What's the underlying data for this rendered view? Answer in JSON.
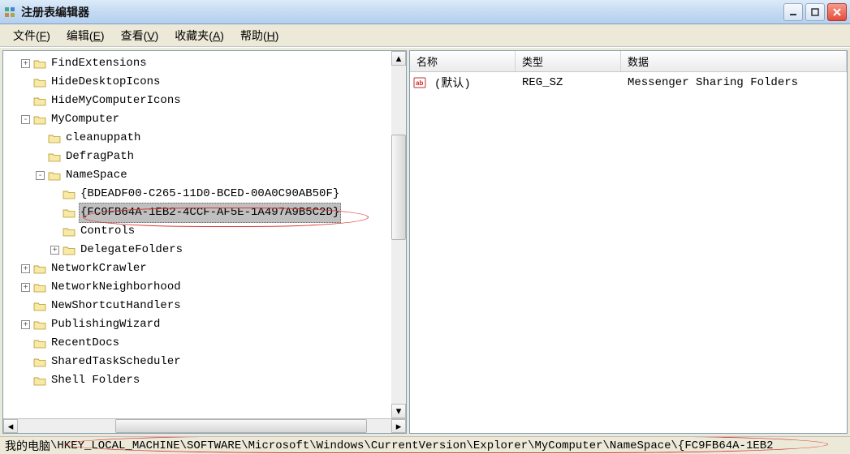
{
  "window": {
    "title": "注册表编辑器"
  },
  "menus": {
    "file": {
      "label": "文件",
      "hotkey": "F"
    },
    "edit": {
      "label": "编辑",
      "hotkey": "E"
    },
    "view": {
      "label": "查看",
      "hotkey": "V"
    },
    "favorites": {
      "label": "收藏夹",
      "hotkey": "A"
    },
    "help": {
      "label": "帮助",
      "hotkey": "H"
    }
  },
  "tree": {
    "items": [
      {
        "indent": 1,
        "toggle": "+",
        "label": "FindExtensions"
      },
      {
        "indent": 1,
        "toggle": "",
        "label": "HideDesktopIcons"
      },
      {
        "indent": 1,
        "toggle": "",
        "label": "HideMyComputerIcons"
      },
      {
        "indent": 1,
        "toggle": "-",
        "label": "MyComputer"
      },
      {
        "indent": 2,
        "toggle": "",
        "label": "cleanuppath"
      },
      {
        "indent": 2,
        "toggle": "",
        "label": "DefragPath"
      },
      {
        "indent": 2,
        "toggle": "-",
        "label": "NameSpace"
      },
      {
        "indent": 3,
        "toggle": "",
        "label": "{BDEADF00-C265-11D0-BCED-00A0C90AB50F}"
      },
      {
        "indent": 3,
        "toggle": "",
        "label": "{FC9FB64A-1EB2-4CCF-AF5E-1A497A9B5C2D}",
        "selected": true
      },
      {
        "indent": 3,
        "toggle": "",
        "label": "Controls"
      },
      {
        "indent": 3,
        "toggle": "+",
        "label": "DelegateFolders"
      },
      {
        "indent": 1,
        "toggle": "+",
        "label": "NetworkCrawler"
      },
      {
        "indent": 1,
        "toggle": "+",
        "label": "NetworkNeighborhood"
      },
      {
        "indent": 1,
        "toggle": "",
        "label": "NewShortcutHandlers"
      },
      {
        "indent": 1,
        "toggle": "+",
        "label": "PublishingWizard"
      },
      {
        "indent": 1,
        "toggle": "",
        "label": "RecentDocs"
      },
      {
        "indent": 1,
        "toggle": "",
        "label": "SharedTaskScheduler"
      },
      {
        "indent": 1,
        "toggle": "",
        "label": "Shell Folders",
        "cut": true
      }
    ]
  },
  "list": {
    "columns": {
      "name": "名称",
      "type": "类型",
      "data": "数据"
    },
    "rows": [
      {
        "name": "(默认)",
        "type": "REG_SZ",
        "data": "Messenger Sharing Folders"
      }
    ]
  },
  "status": {
    "prefix": "我的电脑",
    "path": "\\HKEY_LOCAL_MACHINE\\SOFTWARE\\Microsoft\\Windows\\CurrentVersion\\Explorer\\MyComputer\\NameSpace\\{FC9FB64A-1EB2"
  },
  "icons": {
    "folder_fill": "#f7e9a6",
    "folder_stroke": "#b89b2f"
  }
}
